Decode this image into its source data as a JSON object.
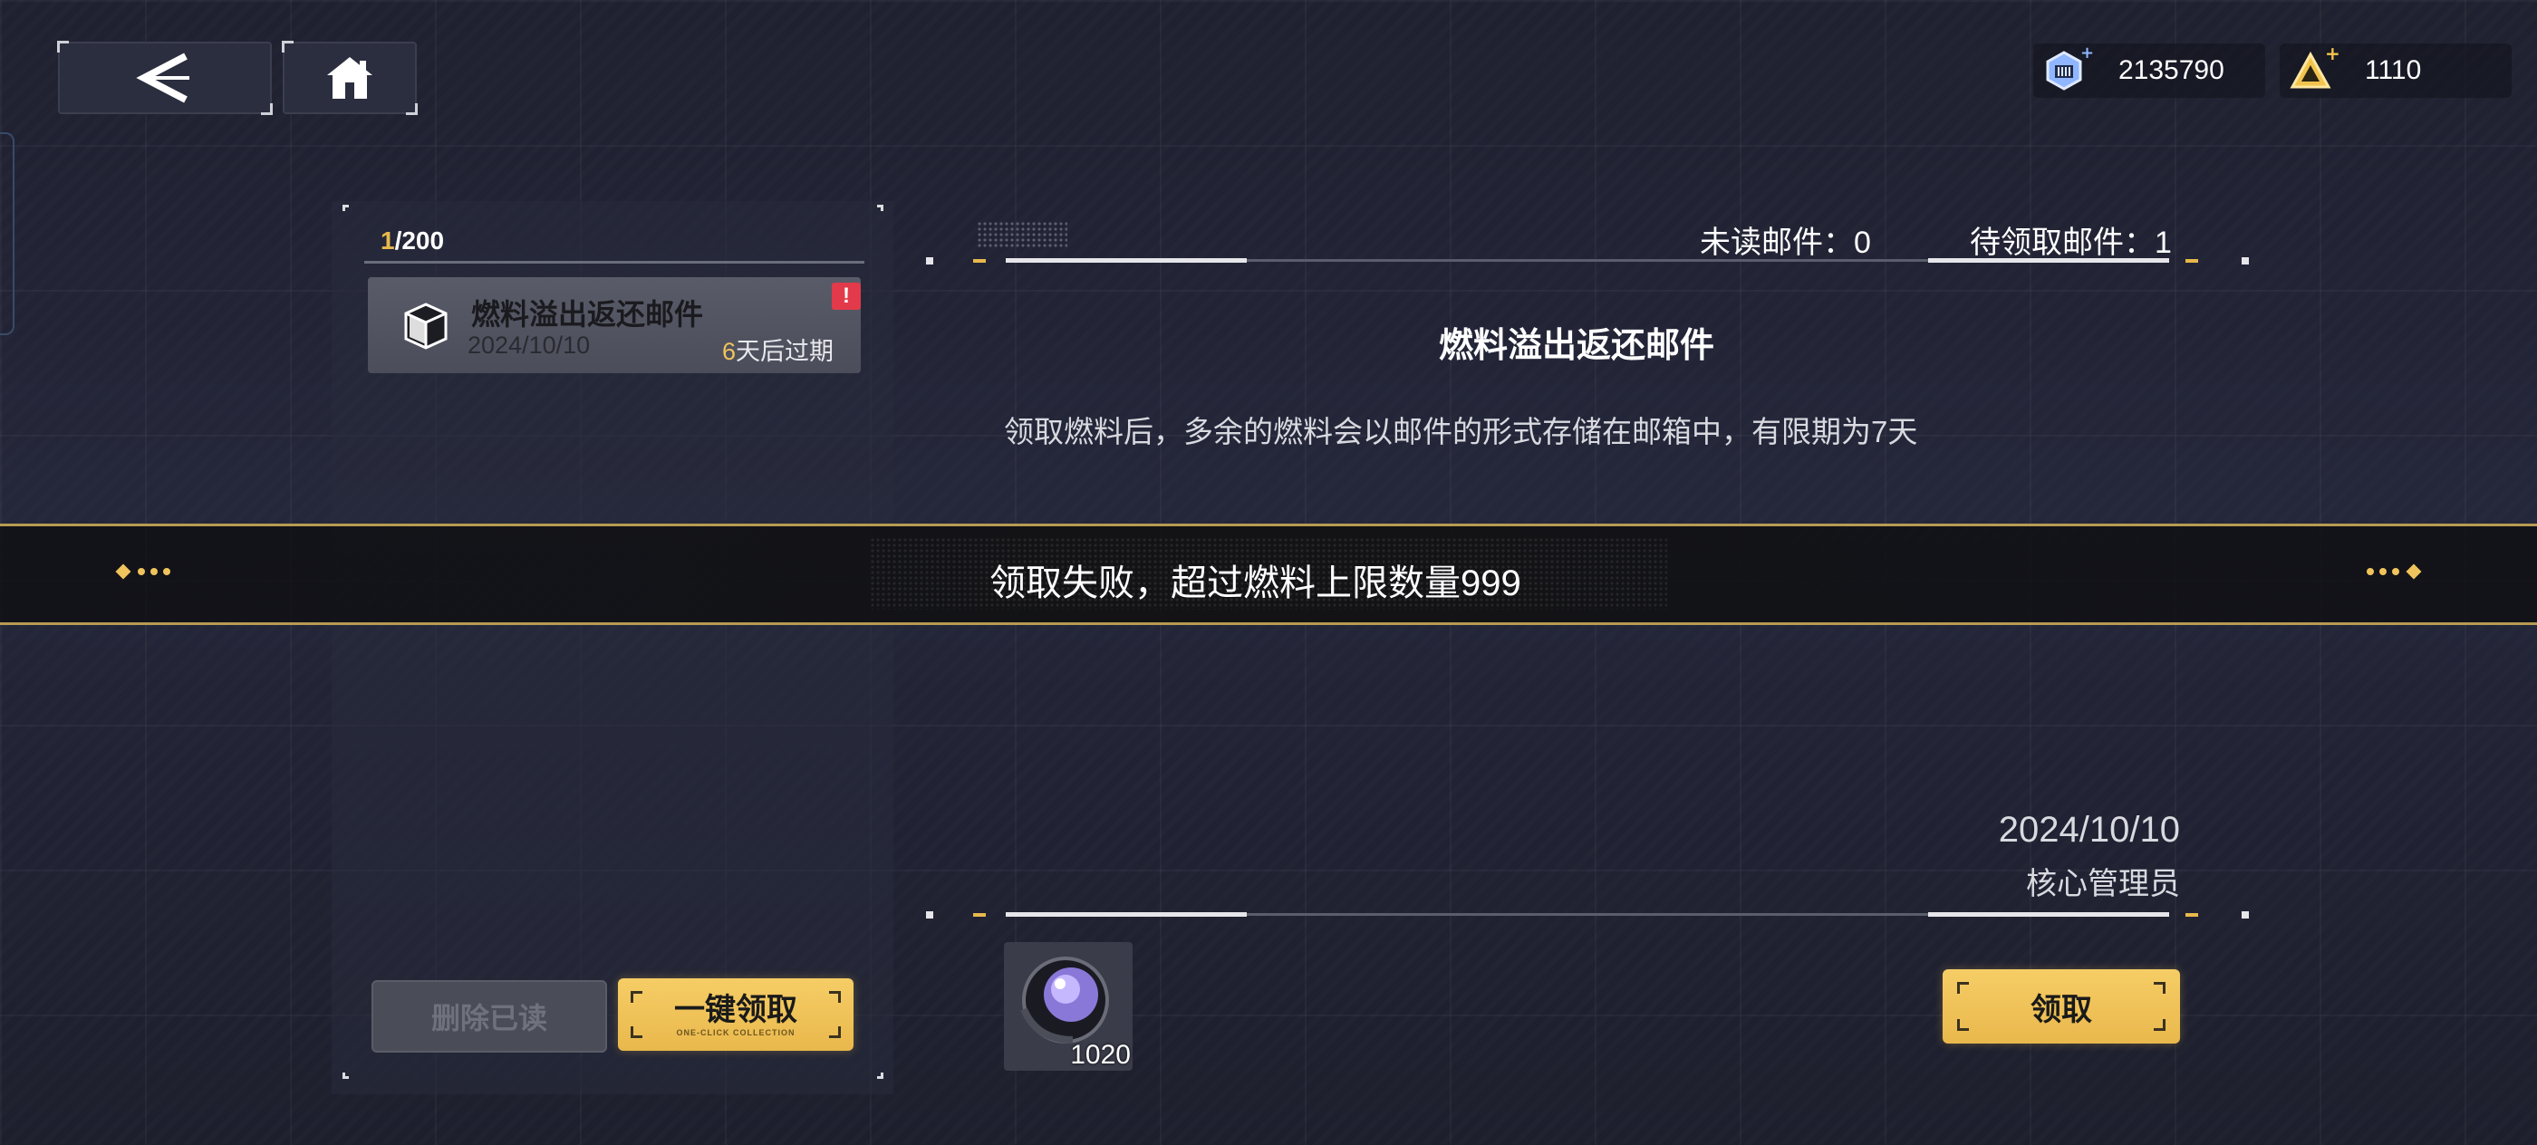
{
  "header": {
    "back_icon": "chevron-left-icon",
    "home_icon": "home-icon",
    "currencies": [
      {
        "icon": "crystal-currency-icon",
        "value": "2135790"
      },
      {
        "icon": "triangle-currency-icon",
        "value": "1110"
      }
    ]
  },
  "mail_list": {
    "count_current": "1",
    "count_total": "/200",
    "items": [
      {
        "title": "燃料溢出返还邮件",
        "date": "2024/10/10",
        "expire_num": "6",
        "expire_text": "天后过期",
        "badge": "!"
      }
    ]
  },
  "left_buttons": {
    "delete_read": "删除已读",
    "one_click": "一键领取",
    "one_click_sub": "ONE-CLICK COLLECTION"
  },
  "mail_detail": {
    "unread_label": "未读邮件：0",
    "pending_label": "待领取邮件：1",
    "title": "燃料溢出返还邮件",
    "body": "领取燃料后，多余的燃料会以邮件的形式存储在邮箱中，有限期为7天",
    "date": "2024/10/10",
    "sender": "核心管理员",
    "attachment": {
      "icon": "fuel-orb-icon",
      "quantity": "1020"
    },
    "claim_button": "领取"
  },
  "toast": {
    "message": "领取失败，超过燃料上限数量999"
  },
  "colors": {
    "accent_gold": "#e9b84c",
    "badge_red": "#e23a4a",
    "background": "#22243a"
  }
}
